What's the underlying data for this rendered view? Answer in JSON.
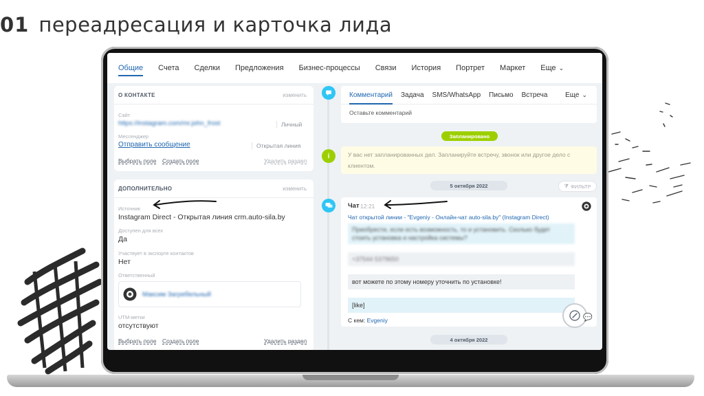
{
  "headline": {
    "number": "01",
    "title": "переадресация и карточка лида"
  },
  "colors": {
    "accent": "#2067b0",
    "green": "#9dcf00",
    "sky": "#2fc6f6",
    "info_bg": "#fffce5"
  },
  "nav": {
    "tabs": [
      "Общие",
      "Счета",
      "Сделки",
      "Предложения",
      "Бизнес-процессы",
      "Связи",
      "История",
      "Портрет",
      "Маркет",
      "Еще"
    ],
    "active": "Общие"
  },
  "contact_card": {
    "title": "О КОНТАКТЕ",
    "edit": "изменить",
    "site_label": "Сайт",
    "site_value": "https://instagram.com/mr.john_frost",
    "site_type": "Личный",
    "messenger_label": "Мессенджер",
    "messenger_value": "Отправить сообщение",
    "messenger_type": "Открытая линия",
    "choose_field": "Выбрать поле",
    "create_field": "Создать поле",
    "delete_section": "Удалить раздел"
  },
  "extra_card": {
    "title": "ДОПОЛНИТЕЛЬНО",
    "edit": "изменить",
    "source_label": "Источник",
    "source_value": "Instagram Direct - Открытая линия crm.auto-sila.by",
    "access_label": "Доступен для всех",
    "access_value": "Да",
    "export_label": "Участвует в экспорте контактов",
    "export_value": "Нет",
    "responsible_label": "Ответственный",
    "responsible_name": "Максим Загребельный",
    "utm_label": "UTM-метки",
    "utm_value": "отсутствуют",
    "choose_field": "Выбрать поле",
    "create_field": "Создать поле",
    "delete_section": "Удалить раздел"
  },
  "editor": {
    "tabs": [
      "Комментарий",
      "Задача",
      "SMS/WhatsApp",
      "Письмо",
      "Встреча",
      "Еще"
    ],
    "active": "Комментарий",
    "placeholder": "Оставьте комментарий"
  },
  "timeline": {
    "planned_badge": "Запланировано",
    "planned_info": "У вас нет запланированных дел. Запланируйте встречу, звонок или другое дело с клиентом.",
    "date1": "5 октября 2022",
    "filter": "ФИЛЬТР",
    "chat_title": "Чат",
    "chat_time": "12:21",
    "chat_link": "Чат открытой линии - \"Evgeniy - Онлайн-чат auto-sila.by\" (Instagram Direct)",
    "msg1": "Приобрести, если есть возможность, то и установить. Сколько будет стоить установка и настройка системы?",
    "msg2": "+37544 5379650",
    "msg3": "вот можете по этому номеру уточнить по установке!",
    "msg4": "[like]",
    "with_label": "С кем:",
    "with_name": "Evgeniy",
    "date2": "4 октября 2022"
  }
}
